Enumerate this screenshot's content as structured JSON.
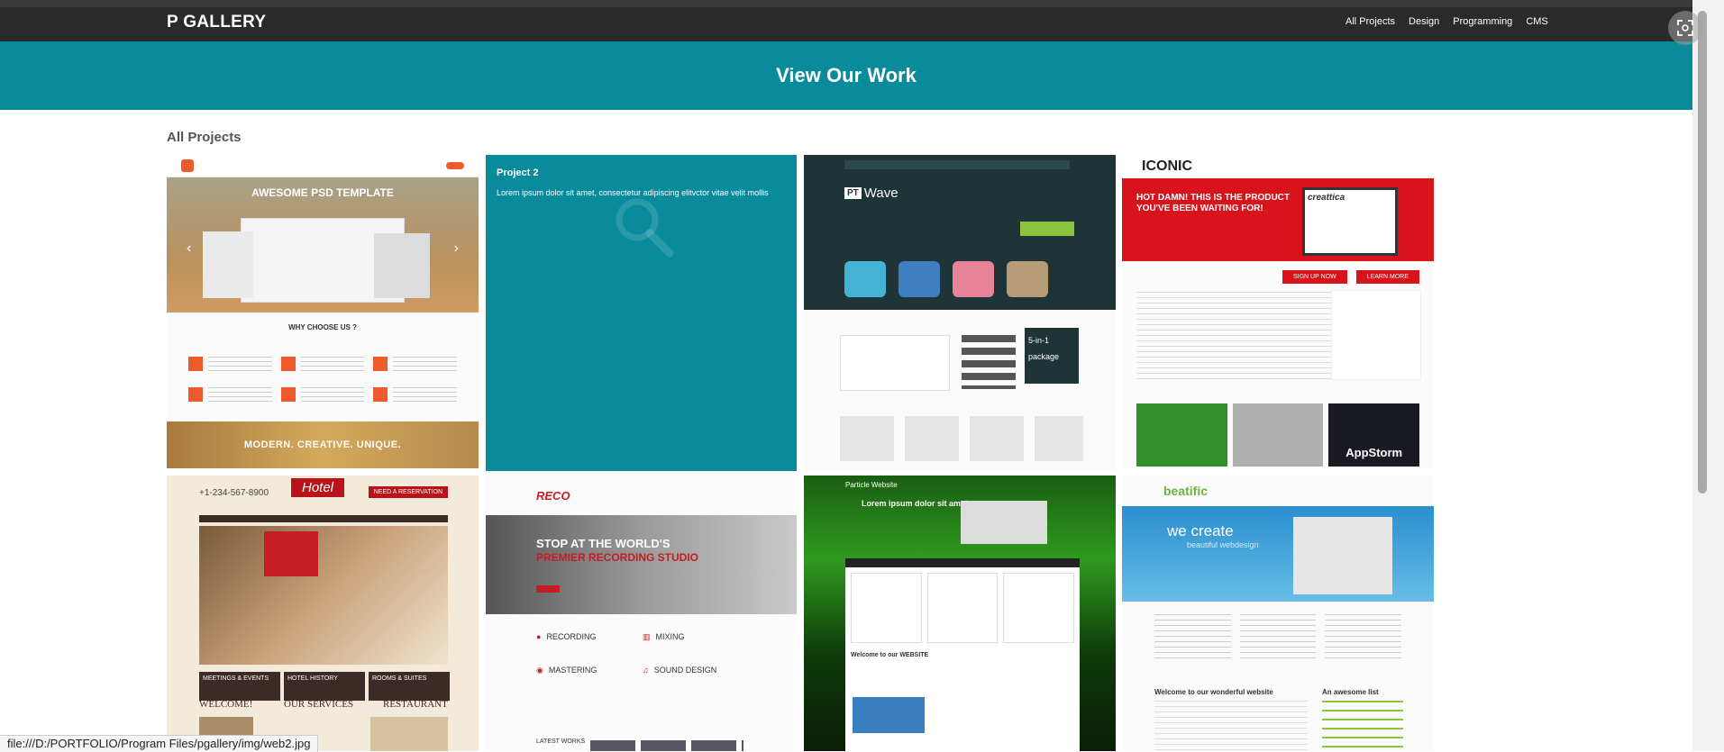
{
  "brand": "P GALLERY",
  "nav": [
    "All Projects",
    "Design",
    "Programming",
    "CMS"
  ],
  "hero_title": "View Our Work",
  "section_title": "All Projects",
  "tiles": [
    {
      "awesome": "AWESOME PSD TEMPLATE",
      "why": "WHY CHOOSE US ?",
      "modern": "MODERN. CREATIVE. UNIQUE."
    },
    {
      "title": "Project 2",
      "text": "Lorem ipsum dolor sit amet, consectetur adipiscing elitvctor vitae velit mollis"
    },
    {
      "brand": "Wave",
      "brand_prefix": "PT",
      "package": "5-in-1 package"
    },
    {
      "brand": "ICONIC",
      "headline": "HOT DAMN! THIS IS THE PRODUCT YOU'VE BEEN WAITING FOR!",
      "creattica": "creattica",
      "signup": "SIGN UP NOW",
      "learn": "LEARN MORE",
      "appstorm": "AppStorm"
    },
    {
      "brand": "Hotel",
      "phone": "+1-234-567-8900",
      "reservation": "NEED A RESERVATION",
      "buttons": [
        "MEETINGS & EVENTS",
        "HOTEL HISTORY",
        "ROOMS & SUITES"
      ],
      "headings": [
        "WELCOME!",
        "OUR SERVICES",
        "RESTAURANT"
      ]
    },
    {
      "brand": "RECO",
      "headline": "STOP AT THE WORLD'S",
      "headline2": "PREMIER RECORDING STUDIO",
      "services": [
        "RECORDING",
        "MIXING",
        "MASTERING",
        "SOUND DESIGN"
      ],
      "latest": "LATEST WORKS"
    },
    {
      "brand": "Particle Website",
      "hero": "Lorem ipsum dolor sit amet",
      "welcome": "Welcome to our WEBSITE"
    },
    {
      "brand": "beatific",
      "hero": "we create",
      "hero2": "beautiful webdesign",
      "welcome": "Welcome to our wonderful website",
      "awesome": "An awesome list"
    }
  ],
  "status_text": "file:///D:/PORTFOLIO/Program Files/pgallery/img/web2.jpg",
  "colors": {
    "topbar": "#2a2a2a",
    "hero": "#0a8b9c",
    "tile_hover": "#0a8b9c"
  }
}
